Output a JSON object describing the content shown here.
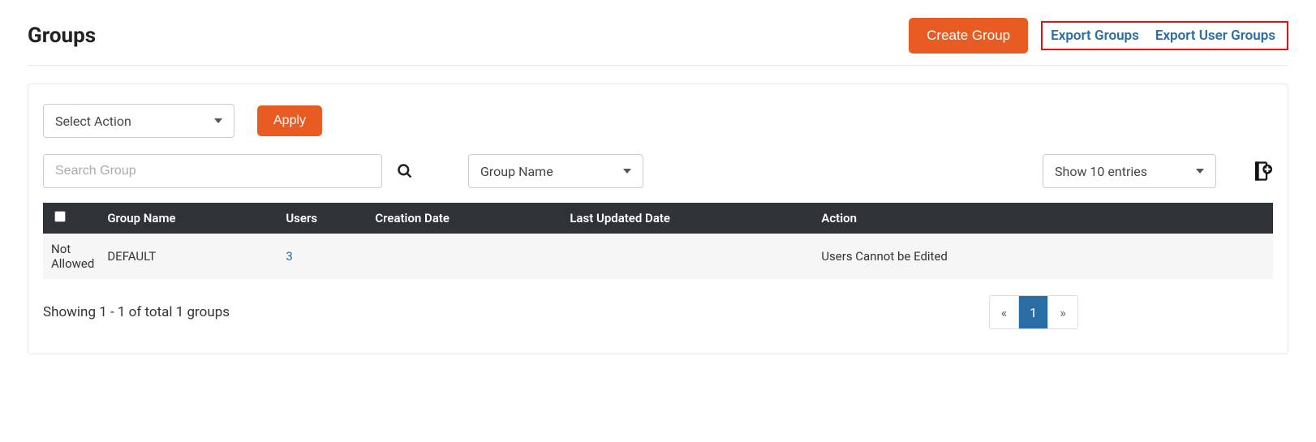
{
  "header": {
    "title": "Groups",
    "create_button": "Create Group",
    "export_groups": "Export Groups",
    "export_user_groups": "Export User Groups"
  },
  "controls": {
    "select_action": "Select Action",
    "apply": "Apply",
    "search_placeholder": "Search Group",
    "filter_by": "Group Name",
    "entries": "Show 10 entries"
  },
  "table": {
    "columns": {
      "c0": "",
      "c1": "Group Name",
      "c2": "Users",
      "c3": "Creation Date",
      "c4": "Last Updated Date",
      "c5": "Action"
    },
    "rows": [
      {
        "select": "Not Allowed",
        "group_name": "DEFAULT",
        "users": "3",
        "creation_date": "",
        "last_updated": "",
        "action": "Users Cannot be Edited"
      }
    ]
  },
  "footer": {
    "showing": "Showing 1 - 1 of total 1 groups",
    "prev": "«",
    "page": "1",
    "next": "»"
  }
}
